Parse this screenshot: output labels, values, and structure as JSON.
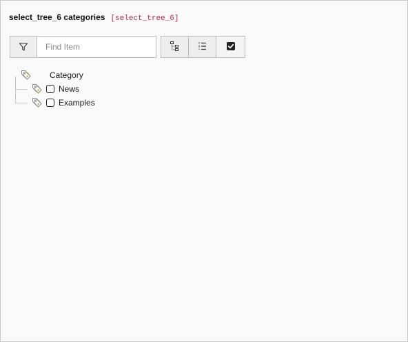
{
  "header": {
    "title": "select_tree_6 categories",
    "code": "[select_tree_6]"
  },
  "search": {
    "placeholder": "Find Item",
    "value": ""
  },
  "toolbar": {
    "buttons": [
      {
        "icon": "tree-structure-icon"
      },
      {
        "icon": "flat-list-icon"
      },
      {
        "icon": "check-square-icon"
      }
    ]
  },
  "tree": {
    "root": {
      "label": "Category",
      "icon": "tags-icon"
    },
    "children": [
      {
        "label": "News",
        "icon": "tags-icon",
        "checked": false
      },
      {
        "label": "Examples",
        "icon": "tags-icon",
        "checked": false
      }
    ]
  },
  "colors": {
    "code_text": "#c7254e",
    "tag_orange": "#f0a030",
    "tag_outline": "#8a8a8a"
  }
}
